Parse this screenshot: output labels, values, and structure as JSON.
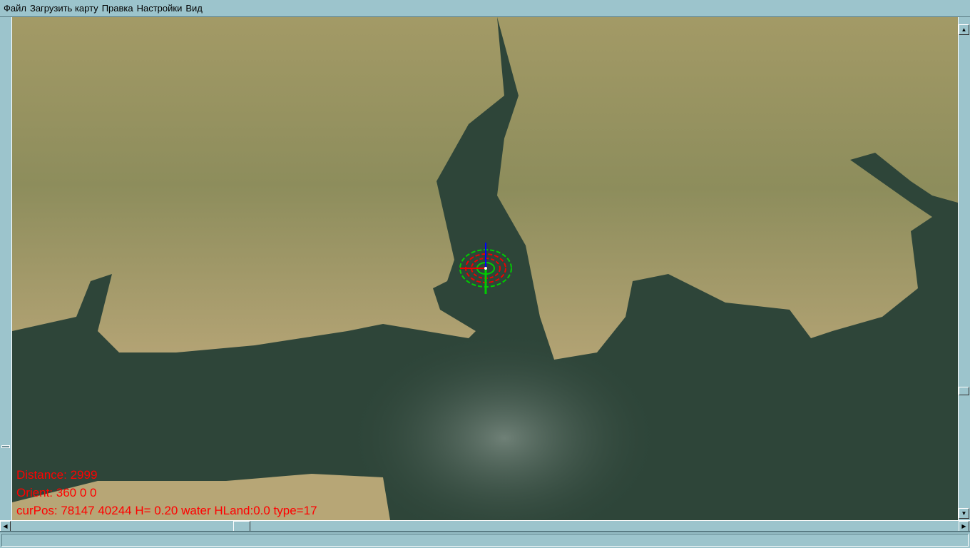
{
  "menu": {
    "items": [
      "Файл",
      "Загрузить карту",
      "Правка",
      "Настройки",
      "Вид"
    ]
  },
  "hud": {
    "distance": "Distance: 2999",
    "orient": "Orient: 360 0 0",
    "curpos": "curPos: 78147 40244 H= 0.20 water HLand:0.0 type=17"
  },
  "scrollbars": {
    "up_arrow": "▲",
    "down_arrow": "▼",
    "left_arrow": "◀",
    "right_arrow": "▶"
  },
  "status": {
    "text": ""
  },
  "colors": {
    "water": "#2e4539",
    "land": "#8f9460",
    "hud_text": "#ff0000",
    "chrome": "#9cc4cc"
  }
}
